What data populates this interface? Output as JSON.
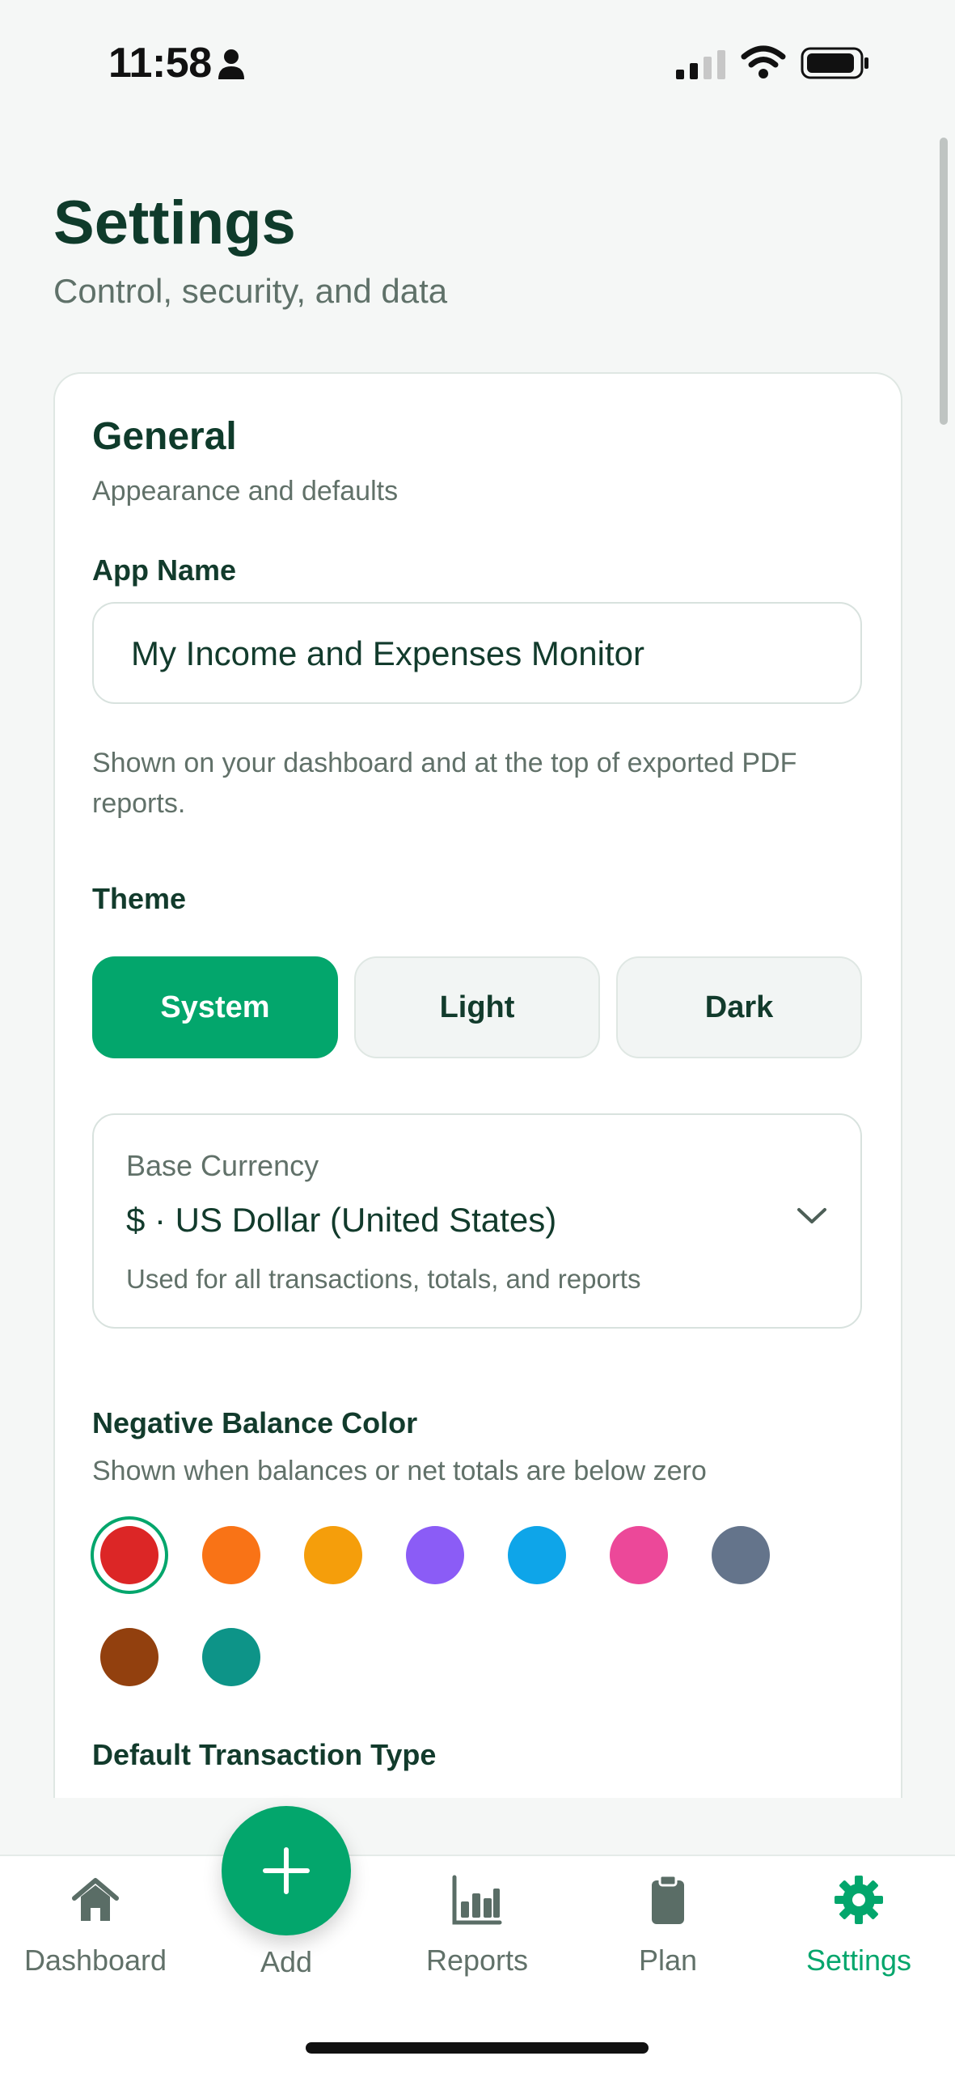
{
  "status_bar": {
    "time": "11:58"
  },
  "header": {
    "title": "Settings",
    "subtitle": "Control, security, and data"
  },
  "general": {
    "title": "General",
    "subtitle": "Appearance and defaults",
    "app_name": {
      "label": "App Name",
      "value": "My Income and Expenses Monitor",
      "help": "Shown on your dashboard and at the top of exported PDF reports."
    },
    "theme": {
      "label": "Theme",
      "options": [
        "System",
        "Light",
        "Dark"
      ],
      "selected": "System"
    },
    "currency": {
      "label": "Base Currency",
      "value": "$ · US Dollar (United States)",
      "note": "Used for all transactions, totals, and reports"
    },
    "negative_color": {
      "label": "Negative Balance Color",
      "help": "Shown when balances or net totals are below zero",
      "swatches": [
        "#dc2626",
        "#f97316",
        "#f59e0b",
        "#8b5cf6",
        "#0ea5e9",
        "#ec4899",
        "#64748b",
        "#92400e",
        "#0d9488"
      ],
      "selected_index": 0
    },
    "default_type": {
      "label": "Default Transaction Type"
    }
  },
  "nav": {
    "items": [
      {
        "label": "Dashboard",
        "icon": "home-icon"
      },
      {
        "label": "Add",
        "icon": "plus-icon"
      },
      {
        "label": "Reports",
        "icon": "bar-chart-icon"
      },
      {
        "label": "Plan",
        "icon": "clipboard-icon"
      },
      {
        "label": "Settings",
        "icon": "gear-icon"
      }
    ],
    "active": "Settings"
  },
  "colors": {
    "accent": "#03a66c",
    "text_dark": "#0f3b2b",
    "text_muted": "#617169"
  }
}
